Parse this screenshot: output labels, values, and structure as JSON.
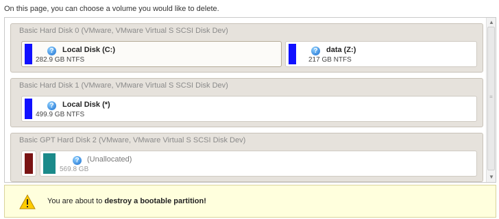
{
  "instruction": "On this page, you can choose a volume you would like to delete.",
  "disks": [
    {
      "header": "Basic Hard Disk 0 (VMware, VMware Virtual S SCSI Disk Dev)",
      "volumes": [
        {
          "name": "Local Disk (C:)",
          "size": "282.9 GB NTFS",
          "color": "#1010ff",
          "selected": true
        },
        {
          "name": "data (Z:)",
          "size": "217 GB NTFS",
          "color": "#1010ff"
        }
      ]
    },
    {
      "header": "Basic Hard Disk 1 (VMware, VMware Virtual S SCSI Disk Dev)",
      "volumes": [
        {
          "name": "Local Disk (*)",
          "size": "499.9 GB NTFS",
          "color": "#1010ff"
        }
      ]
    },
    {
      "header": "Basic GPT Hard Disk 2 (VMware, VMware Virtual S SCSI Disk Dev)",
      "volumes": [
        {
          "name": "",
          "size": "",
          "color": "#7a1414"
        },
        {
          "name": "(Unallocated)",
          "size": "569.8 GB",
          "color": "#1b8a8a"
        }
      ]
    }
  ],
  "warning": {
    "prefix": "You are about to ",
    "emphasis": "destroy a bootable partition!",
    "icon": "warning-triangle-icon"
  }
}
